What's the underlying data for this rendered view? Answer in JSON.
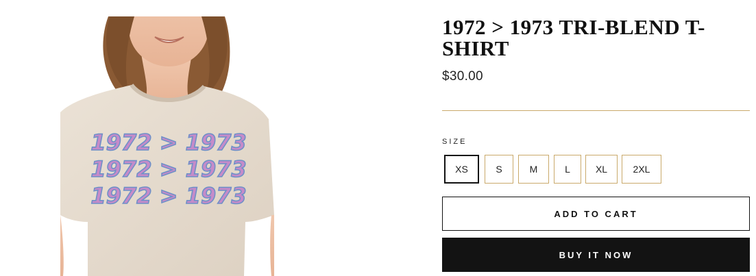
{
  "product": {
    "title": "1972 > 1973 TRI-BLEND T-SHIRT",
    "price": "$30.00",
    "image": {
      "shirt_print": [
        "1972 > 1973",
        "1972 > 1973",
        "1972 > 1973"
      ]
    }
  },
  "size_selector": {
    "label": "SIZE",
    "options": [
      "XS",
      "S",
      "M",
      "L",
      "XL",
      "2XL"
    ],
    "selected": "XS"
  },
  "actions": {
    "add_to_cart": "ADD TO CART",
    "buy_now": "BUY IT NOW"
  },
  "colors": {
    "accent_gold": "#c9a96a",
    "shirt_heather": "#e6dccf",
    "print_pink": "#c58bc9",
    "print_blue": "#6f90c8",
    "buy_button": "#131313"
  }
}
